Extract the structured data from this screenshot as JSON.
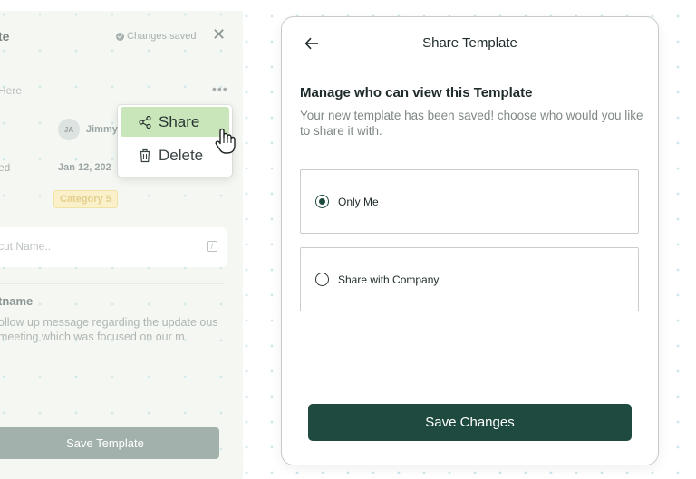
{
  "background_panel": {
    "title_fragment": "te",
    "saved_status": "Changes saved",
    "field_placeholder_fragment": "Here",
    "more_label": "•••",
    "author_initials": "JA",
    "author_name": "Jimmy",
    "date_label_fragment": "ed",
    "date_value": "Jan 12, 202",
    "category_badge": "Category 5",
    "shortcut_placeholder": "cut Name..",
    "shortcut_key": "/",
    "section_title": "tname",
    "body_text": "ollow up message regarding the update ous meeting which was focused on our m.",
    "save_template_label": "Save Template"
  },
  "context_menu": {
    "items": [
      {
        "label": "Share",
        "icon": "share-icon"
      },
      {
        "label": "Delete",
        "icon": "trash-icon"
      }
    ]
  },
  "modal": {
    "title": "Share Template",
    "heading": "Manage who can view this Template",
    "description": "Your new template has been saved! choose who would you like to share it with.",
    "options": [
      {
        "label": "Only Me",
        "selected": true
      },
      {
        "label": "Share with Company",
        "selected": false
      }
    ],
    "save_label": "Save Changes"
  },
  "colors": {
    "primary": "#1f4a40",
    "menu_highlight": "#c8e6b9",
    "category_badge_bg": "#faf0c9",
    "disabled_button": "#a3b1ad"
  }
}
